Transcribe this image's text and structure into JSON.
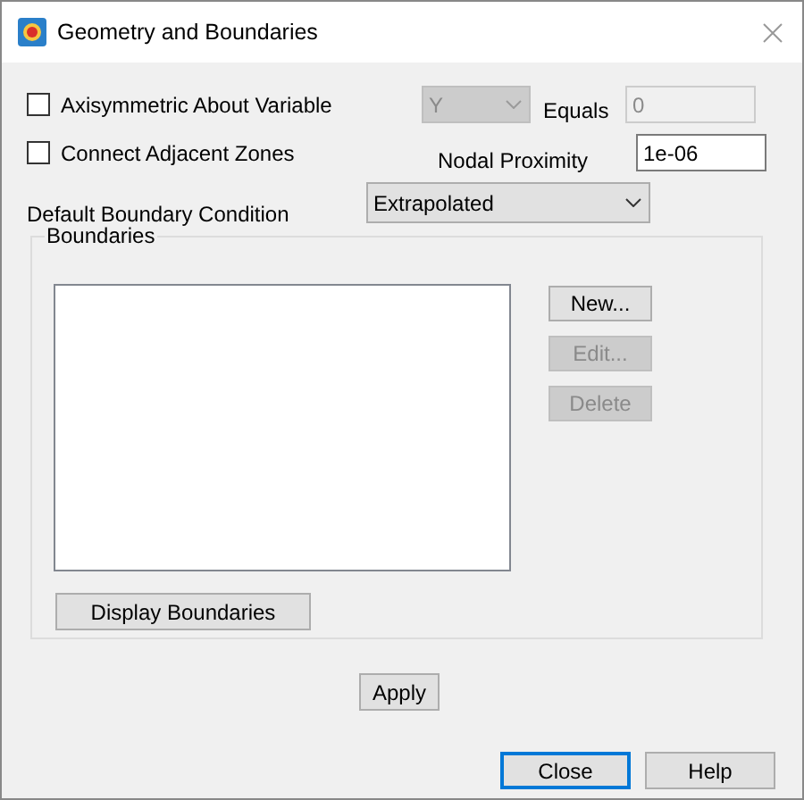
{
  "window": {
    "title": "Geometry and Boundaries"
  },
  "checkboxes": [
    {
      "label": "Axisymmetric About Variable",
      "checked": false
    },
    {
      "label": "Connect Adjacent Zones",
      "checked": false
    }
  ],
  "axis_variable": {
    "value": "Y",
    "disabled": true
  },
  "equals": {
    "label": "Equals",
    "value": "0",
    "disabled": true
  },
  "nodal_proximity": {
    "label": "Nodal Proximity",
    "value": "1e-06"
  },
  "default_boundary_condition": {
    "label": "Default Boundary Condition",
    "value": "Extrapolated"
  },
  "boundaries": {
    "title": "Boundaries",
    "buttons": [
      {
        "label": "New...",
        "disabled": false
      },
      {
        "label": "Edit...",
        "disabled": true
      },
      {
        "label": "Delete",
        "disabled": true
      }
    ],
    "display_button": "Display Boundaries"
  },
  "apply_button": "Apply",
  "footer_buttons": [
    {
      "label": "Close",
      "focused": true
    },
    {
      "label": "Help",
      "focused": false
    }
  ]
}
